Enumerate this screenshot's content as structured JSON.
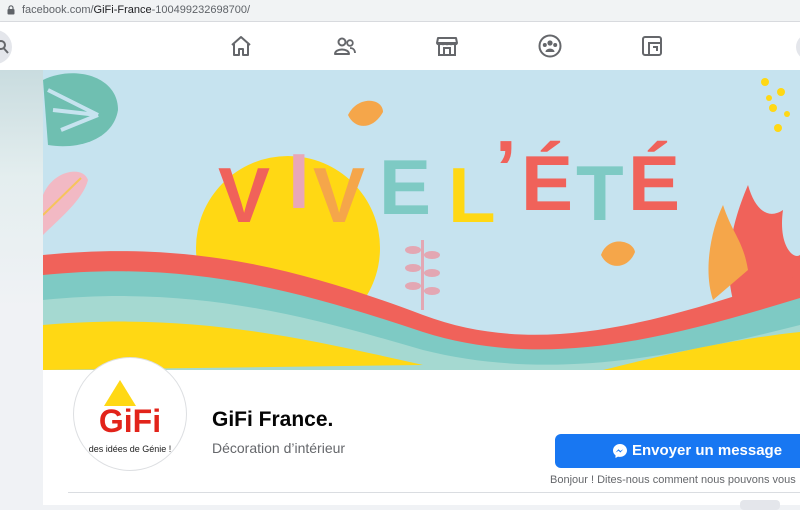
{
  "browser": {
    "url_host": "facebook.com/",
    "url_path": "GiFi-France",
    "url_rest": "-100499232698700/"
  },
  "nav": {
    "icons": [
      "home-icon",
      "friends-icon",
      "marketplace-icon",
      "groups-icon",
      "gaming-icon"
    ]
  },
  "cover": {
    "headline_letters": [
      "V",
      "I",
      "V",
      "E",
      "L",
      "’",
      "É",
      "T",
      "É"
    ],
    "colors": {
      "sky": "#c6e3ef",
      "sun": "#ffd814",
      "red": "#f0625a",
      "orange": "#f5a64a",
      "teal": "#7ecac4",
      "yellow": "#ffd814"
    }
  },
  "profile": {
    "name": "GiFi France.",
    "category": "Décoration d’intérieur",
    "logo_text": "GiFi",
    "logo_tagline": "des idées de Génie !"
  },
  "actions": {
    "message_button": "Envoyer un message",
    "message_hint": "Bonjour ! Dites-nous comment nous pouvons vous"
  },
  "colors": {
    "brand_blue": "#1877f2",
    "text_primary": "#050505",
    "text_secondary": "#65676b"
  }
}
